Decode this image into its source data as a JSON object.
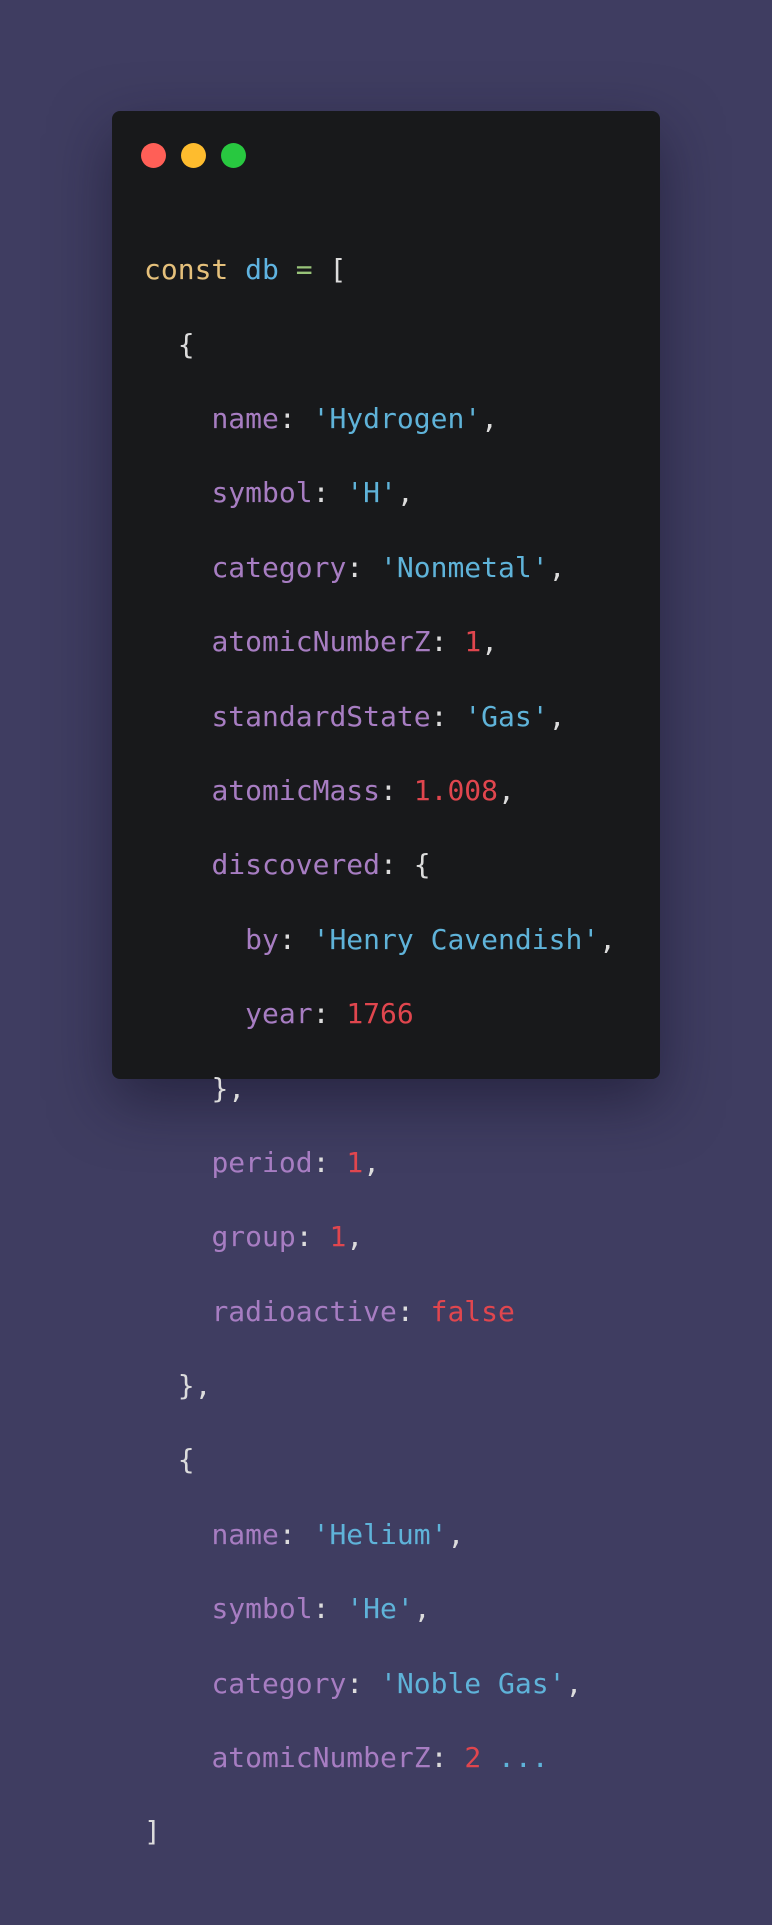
{
  "window": {
    "buttons": [
      "close",
      "minimize",
      "maximize"
    ],
    "colors": {
      "background": "#3f3d61",
      "window": "#18191b",
      "close": "#ff5f57",
      "minimize": "#febc2e",
      "maximize": "#28c840",
      "keyword": "#e5c07b",
      "identifier": "#5fb3e0",
      "operator": "#98c379",
      "property": "#a77dc2",
      "string": "#5fb3d9",
      "number": "#e0464e",
      "punctuation": "#dcdcdc"
    }
  },
  "code": {
    "keyword": "const",
    "identifier": "db",
    "operator": "=",
    "open_bracket": "[",
    "close_bracket": "]",
    "open_brace": "{",
    "close_brace_comma": "},",
    "items": [
      {
        "name_key": "name",
        "name_value": "'Hydrogen'",
        "symbol_key": "symbol",
        "symbol_value": "'H'",
        "category_key": "category",
        "category_value": "'Nonmetal'",
        "atomic_number_key": "atomicNumberZ",
        "atomic_number_value": "1",
        "state_key": "standardState",
        "state_value": "'Gas'",
        "mass_key": "atomicMass",
        "mass_value": "1.008",
        "discovered_key": "discovered",
        "by_key": "by",
        "by_value": "'Henry Cavendish'",
        "year_key": "year",
        "year_value": "1766",
        "period_key": "period",
        "period_value": "1",
        "group_key": "group",
        "group_value": "1",
        "radioactive_key": "radioactive",
        "radioactive_value": "false"
      },
      {
        "name_key": "name",
        "name_value": "'Helium'",
        "symbol_key": "symbol",
        "symbol_value": "'He'",
        "category_key": "category",
        "category_value": "'Noble Gas'",
        "atomic_number_key": "atomicNumberZ",
        "atomic_number_value": "2",
        "ellipsis": "..."
      }
    ]
  }
}
